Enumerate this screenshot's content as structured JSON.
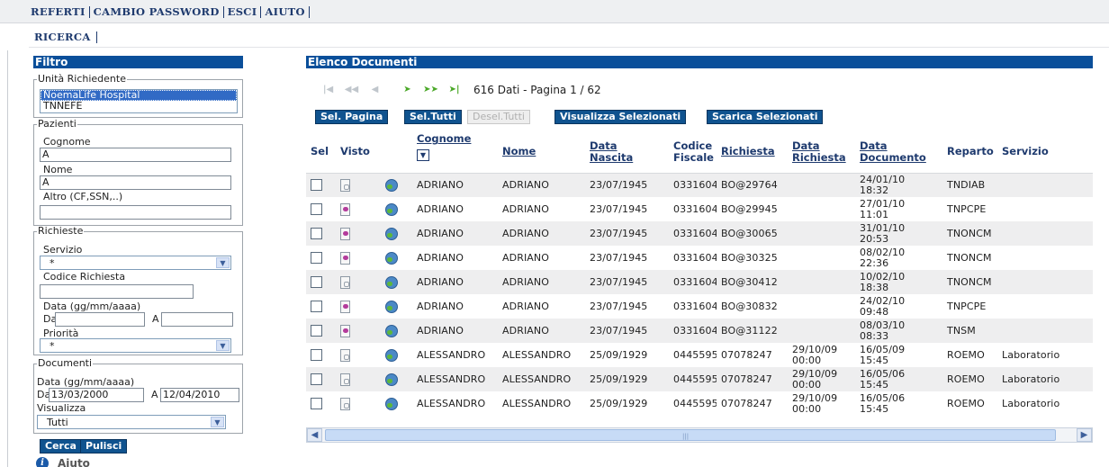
{
  "topmenu": {
    "items": [
      "REFERTI",
      "CAMBIO PASSWORD",
      "ESCI",
      "AIUTO"
    ]
  },
  "submenu": {
    "label": "RICERCA"
  },
  "filter": {
    "title": "Filtro",
    "unita": {
      "legend": "Unità Richiedente",
      "options": [
        "NoemaLife Hospital",
        "TNNEFE"
      ],
      "selected": "NoemaLife Hospital"
    },
    "pazienti": {
      "legend": "Pazienti",
      "cognome_label": "Cognome",
      "cognome_value": "A",
      "nome_label": "Nome",
      "nome_value": "A",
      "altro_label": "Altro (CF,SSN,..)",
      "altro_value": ""
    },
    "richieste": {
      "legend": "Richieste",
      "servizio_label": "Servizio",
      "servizio_value": "*",
      "codice_label": "Codice Richiesta",
      "codice_value": "",
      "data_label": "Data (gg/mm/aaaa)",
      "da_label": "Da",
      "da_value": "",
      "a_label": "A",
      "a_value": "",
      "priorita_label": "Priorità",
      "priorita_value": "*"
    },
    "documenti": {
      "legend": "Documenti",
      "data_label": "Data (gg/mm/aaaa)",
      "da_label": "Da",
      "da_value": "13/03/2000",
      "a_label": "A",
      "a_value": "12/04/2010",
      "visualizza_label": "Visualizza",
      "visualizza_value": "Tutti"
    },
    "buttons": {
      "cerca": "Cerca",
      "pulisci": "Pulisci"
    },
    "aiuto": "Aiuto"
  },
  "docs": {
    "title": "Elenco Documenti",
    "count_text": "616 Dati - Pagina 1 / 62",
    "buttons": {
      "sel_pagina": "Sel. Pagina",
      "sel_tutti": "Sel.Tutti",
      "desel_tutti": "Desel.Tutti",
      "visualizza_sel": "Visualizza Selezionati",
      "scarica_sel": "Scarica Selezionati"
    },
    "columns": {
      "sel": "Sel",
      "visto": "Visto",
      "cognome": "Cognome",
      "nome": "Nome",
      "data_nascita_1": "Data",
      "data_nascita_2": "Nascita",
      "codice_fiscale_1": "Codice",
      "codice_fiscale_2": "Fiscale",
      "richiesta": "Richiesta",
      "data_richiesta_1": "Data",
      "data_richiesta_2": "Richiesta",
      "data_documento_1": "Data",
      "data_documento_2": "Documento",
      "reparto": "Reparto",
      "servizio": "Servizio"
    },
    "rows": [
      {
        "visto": "unviewed",
        "cognome": "ADRIANO",
        "nome": "ADRIANO",
        "nascita": "23/07/1945",
        "cf": "0331604",
        "richiesta": "BO@29764",
        "data_richiesta_1": "",
        "data_richiesta_2": "",
        "data_doc_1": "24/01/10",
        "data_doc_2": "18:32",
        "reparto": "TNDIAB",
        "servizio": ""
      },
      {
        "visto": "viewed",
        "cognome": "ADRIANO",
        "nome": "ADRIANO",
        "nascita": "23/07/1945",
        "cf": "0331604",
        "richiesta": "BO@29945",
        "data_richiesta_1": "",
        "data_richiesta_2": "",
        "data_doc_1": "27/01/10",
        "data_doc_2": "11:01",
        "reparto": "TNPCPE",
        "servizio": ""
      },
      {
        "visto": "viewed",
        "cognome": "ADRIANO",
        "nome": "ADRIANO",
        "nascita": "23/07/1945",
        "cf": "0331604",
        "richiesta": "BO@30065",
        "data_richiesta_1": "",
        "data_richiesta_2": "",
        "data_doc_1": "31/01/10",
        "data_doc_2": "20:53",
        "reparto": "TNONCM",
        "servizio": ""
      },
      {
        "visto": "viewed",
        "cognome": "ADRIANO",
        "nome": "ADRIANO",
        "nascita": "23/07/1945",
        "cf": "0331604",
        "richiesta": "BO@30325",
        "data_richiesta_1": "",
        "data_richiesta_2": "",
        "data_doc_1": "08/02/10",
        "data_doc_2": "22:36",
        "reparto": "TNONCM",
        "servizio": ""
      },
      {
        "visto": "unviewed",
        "cognome": "ADRIANO",
        "nome": "ADRIANO",
        "nascita": "23/07/1945",
        "cf": "0331604",
        "richiesta": "BO@30412",
        "data_richiesta_1": "",
        "data_richiesta_2": "",
        "data_doc_1": "10/02/10",
        "data_doc_2": "18:38",
        "reparto": "TNONCM",
        "servizio": ""
      },
      {
        "visto": "viewed",
        "cognome": "ADRIANO",
        "nome": "ADRIANO",
        "nascita": "23/07/1945",
        "cf": "0331604",
        "richiesta": "BO@30832",
        "data_richiesta_1": "",
        "data_richiesta_2": "",
        "data_doc_1": "24/02/10",
        "data_doc_2": "09:48",
        "reparto": "TNPCPE",
        "servizio": ""
      },
      {
        "visto": "viewed",
        "cognome": "ADRIANO",
        "nome": "ADRIANO",
        "nascita": "23/07/1945",
        "cf": "0331604",
        "richiesta": "BO@31122",
        "data_richiesta_1": "",
        "data_richiesta_2": "",
        "data_doc_1": "08/03/10",
        "data_doc_2": "08:33",
        "reparto": "TNSM",
        "servizio": ""
      },
      {
        "visto": "unviewed",
        "cognome": "ALESSANDRO",
        "nome": "ALESSANDRO",
        "nascita": "25/09/1929",
        "cf": "0445595",
        "richiesta": "07078247",
        "data_richiesta_1": "29/10/09",
        "data_richiesta_2": "00:00",
        "data_doc_1": "16/05/09",
        "data_doc_2": "15:45",
        "reparto": "ROEMO",
        "servizio": "Laboratorio"
      },
      {
        "visto": "unviewed",
        "cognome": "ALESSANDRO",
        "nome": "ALESSANDRO",
        "nascita": "25/09/1929",
        "cf": "0445595",
        "richiesta": "07078247",
        "data_richiesta_1": "29/10/09",
        "data_richiesta_2": "00:00",
        "data_doc_1": "16/05/06",
        "data_doc_2": "15:45",
        "reparto": "ROEMO",
        "servizio": "Laboratorio"
      },
      {
        "visto": "unviewed",
        "cognome": "ALESSANDRO",
        "nome": "ALESSANDRO",
        "nascita": "25/09/1929",
        "cf": "0445595",
        "richiesta": "07078247",
        "data_richiesta_1": "29/10/09",
        "data_richiesta_2": "00:00",
        "data_doc_1": "16/05/06",
        "data_doc_2": "15:45",
        "reparto": "ROEMO",
        "servizio": "Laboratorio"
      }
    ]
  },
  "colors": {
    "header_blue": "#0a4f9a",
    "link_blue": "#1e3a6e",
    "row_alt": "#eeeeef"
  }
}
